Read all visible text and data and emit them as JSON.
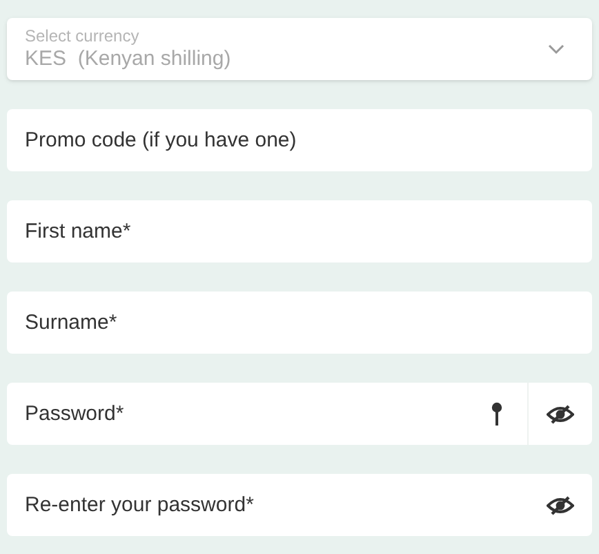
{
  "currency_select": {
    "label": "Select currency",
    "value": "KES  (Kenyan shilling)"
  },
  "fields": [
    {
      "kind": "text",
      "placeholder": "Promo code (if you have one)"
    },
    {
      "kind": "text",
      "placeholder": "First name*"
    },
    {
      "kind": "text",
      "placeholder": "Surname*"
    },
    {
      "kind": "password-generate",
      "placeholder": "Password*"
    },
    {
      "kind": "password",
      "placeholder": "Re-enter your password*"
    }
  ]
}
